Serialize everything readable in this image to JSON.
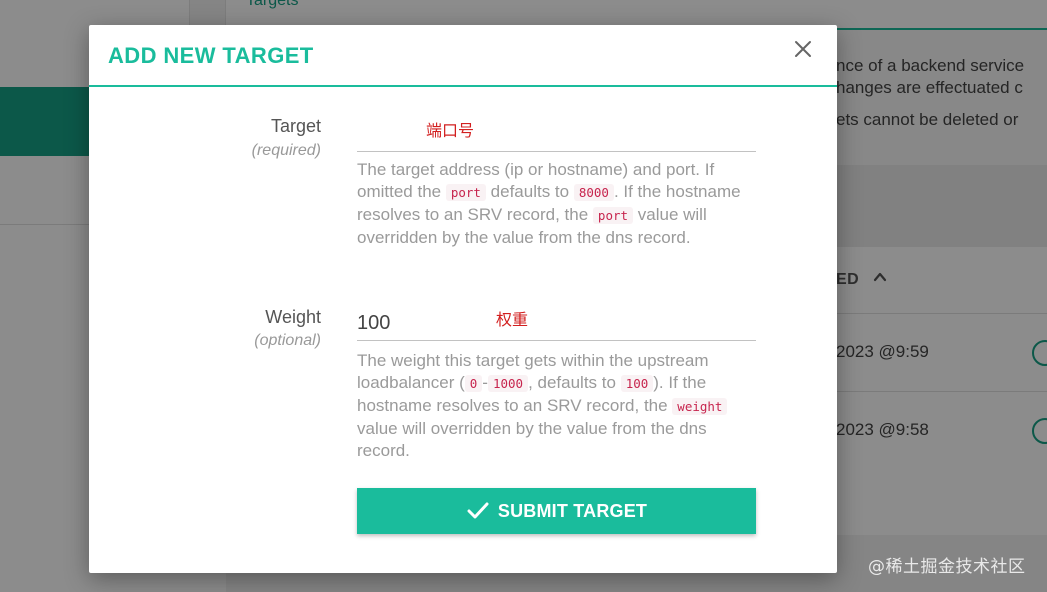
{
  "background": {
    "tab_label": "Targets",
    "info_lines": [
      "nce of a backend service",
      "hanges are effectuated c",
      "ets cannot be deleted or"
    ],
    "column_header": "ED",
    "rows": [
      {
        "date": "2023 @9:59"
      },
      {
        "date": "2023 @9:58"
      }
    ],
    "watermark": "@稀土掘金技术社区"
  },
  "modal": {
    "title": "ADD NEW TARGET",
    "close_glyph": "×",
    "target": {
      "label": "Target",
      "sublabel": "(required)",
      "value": "",
      "annotation": "端口号",
      "help": {
        "p1": "The target address (ip or hostname) and port. If omitted the ",
        "c1": "port",
        "p2": " defaults to ",
        "c2": "8000",
        "p3": ". If the hostname resolves to an SRV record, the ",
        "c3": "port",
        "p4": " value will overridden by the value from the dns record."
      }
    },
    "weight": {
      "label": "Weight",
      "sublabel": "(optional)",
      "value": "100",
      "annotation": "权重",
      "help": {
        "p1": "The weight this target gets within the upstream loadbalancer (",
        "c1": "0",
        "p2": "-",
        "c2": "1000",
        "p3": ", defaults to ",
        "c3": "100",
        "p4": "). If the hostname resolves to an SRV record, the ",
        "c4": "weight",
        "p5": " value will overridden by the value from the dns record."
      }
    },
    "submit_label": "SUBMIT TARGET"
  },
  "colors": {
    "accent": "#1abc9c",
    "accent_dark": "#16a085",
    "code_text": "#c7254e",
    "annotation": "#d21f1f"
  },
  "icons": {
    "close": "close-icon",
    "submit": "check-icon",
    "sort": "chevron-up-icon",
    "status": "check-circle-icon"
  }
}
